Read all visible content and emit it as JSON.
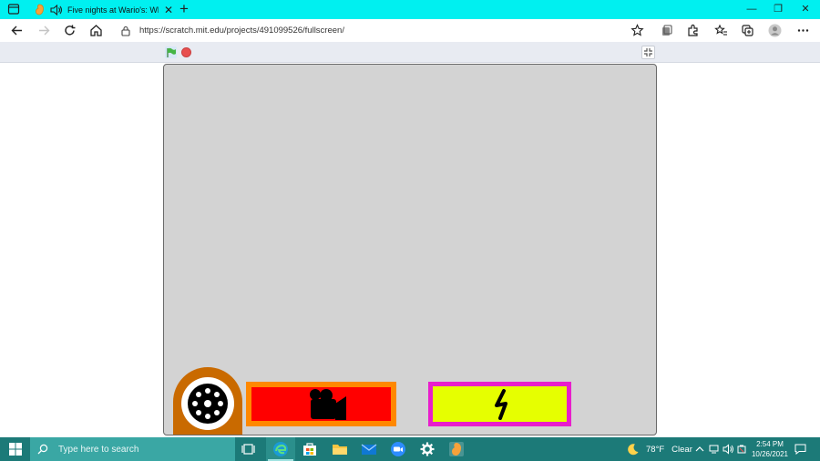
{
  "browser": {
    "tab": {
      "title": "Five nights at Wario's: What",
      "close_glyph": "✕"
    },
    "new_tab_glyph": "+",
    "window_controls": {
      "minimize": "—",
      "restore": "❐",
      "close": "✕"
    },
    "address": {
      "url": "https://scratch.mit.edu/projects/491099526/fullscreen/"
    },
    "colors": {
      "tabbar": "#00f0f0"
    }
  },
  "scratch": {
    "controls": {
      "green_flag": "green-flag-icon",
      "stop": "stop-icon",
      "exit_fullscreen": "exit-fullscreen-icon"
    },
    "stage": {
      "background": "#d3d3d3",
      "elements": {
        "fan": {
          "icon": "fan-icon",
          "color": "#c96a00"
        },
        "camera_panel": {
          "icon": "camera-icon",
          "border": "#ff8800",
          "fill": "#ff0000"
        },
        "power_panel": {
          "icon": "lightning-icon",
          "border": "#e81ecc",
          "fill": "#e6ff00"
        }
      }
    }
  },
  "taskbar": {
    "search_placeholder": "Type here to search",
    "weather": {
      "temp": "78°F",
      "condition": "Clear",
      "icon": "moon-icon"
    },
    "clock": {
      "time": "2:54 PM",
      "date": "10/26/2021"
    },
    "apps": [
      "task-view-icon",
      "edge-icon",
      "store-icon",
      "file-explorer-icon",
      "mail-icon",
      "zoom-icon",
      "settings-icon",
      "scratch-icon"
    ],
    "color": "#1c7a78"
  }
}
